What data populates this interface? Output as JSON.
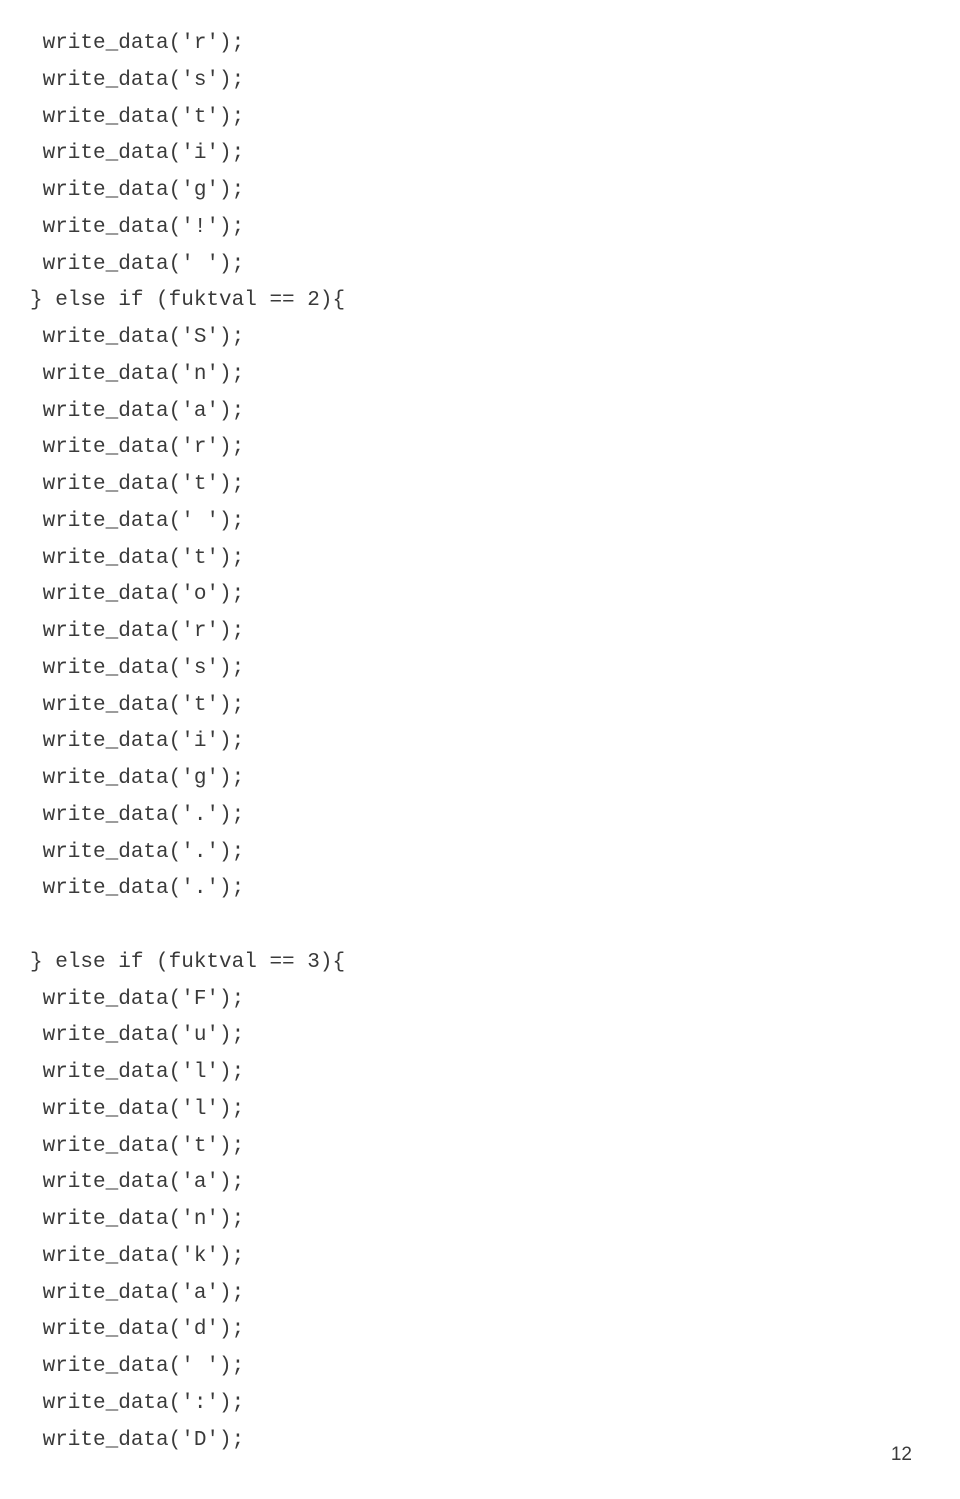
{
  "code": {
    "lines": [
      " write_data('r');",
      " write_data('s');",
      " write_data('t');",
      " write_data('i');",
      " write_data('g');",
      " write_data('!');",
      " write_data(' ');",
      "} else if (fuktval == 2){",
      " write_data('S');",
      " write_data('n');",
      " write_data('a');",
      " write_data('r');",
      " write_data('t');",
      " write_data(' ');",
      " write_data('t');",
      " write_data('o');",
      " write_data('r');",
      " write_data('s');",
      " write_data('t');",
      " write_data('i');",
      " write_data('g');",
      " write_data('.');",
      " write_data('.');",
      " write_data('.');",
      "",
      "} else if (fuktval == 3){",
      " write_data('F');",
      " write_data('u');",
      " write_data('l');",
      " write_data('l');",
      " write_data('t');",
      " write_data('a');",
      " write_data('n');",
      " write_data('k');",
      " write_data('a');",
      " write_data('d');",
      " write_data(' ');",
      " write_data(':');",
      " write_data('D');"
    ]
  },
  "page_number": "12"
}
